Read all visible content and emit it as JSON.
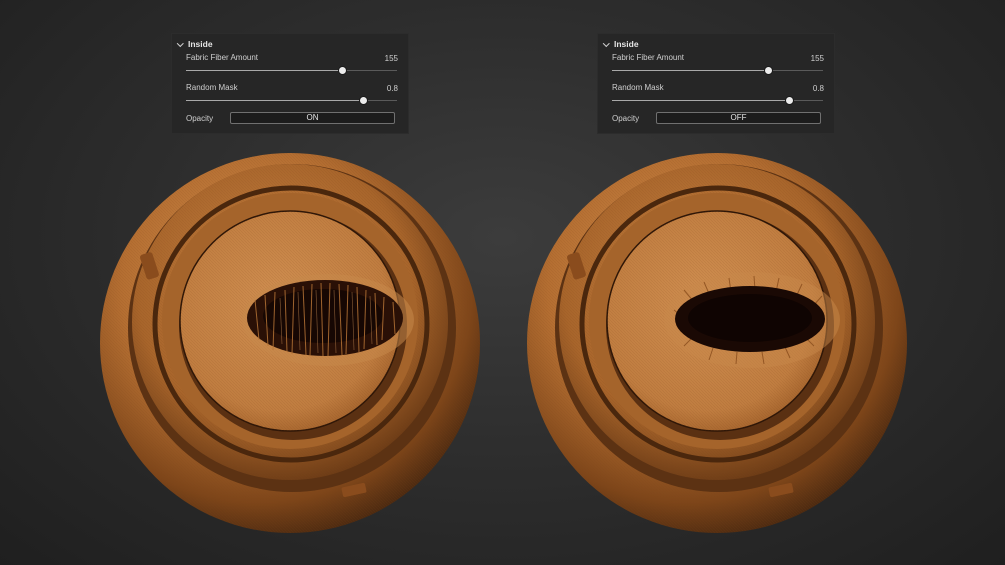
{
  "panels": [
    {
      "section_title": "Inside",
      "fabric_fiber_label": "Fabric Fiber Amount",
      "fabric_fiber_value": "155",
      "fabric_fiber_fraction": 0.74,
      "random_mask_label": "Random Mask",
      "random_mask_value": "0.8",
      "random_mask_fraction": 0.84,
      "opacity_label": "Opacity",
      "opacity_state": "ON"
    },
    {
      "section_title": "Inside",
      "fabric_fiber_label": "Fabric Fiber Amount",
      "fabric_fiber_value": "155",
      "fabric_fiber_fraction": 0.74,
      "random_mask_label": "Random Mask",
      "random_mask_value": "0.8",
      "random_mask_fraction": 0.84,
      "opacity_label": "Opacity",
      "opacity_state": "OFF"
    }
  ],
  "colors": {
    "background": "#2e2e2e",
    "panel_background": "#262626",
    "material_base": "#c07a3b",
    "material_highlight": "#dc9a58",
    "material_shadow": "#5e3212",
    "hole_dark": "#1a0904"
  },
  "icons": {
    "section_toggle": "chevron-down-icon"
  }
}
